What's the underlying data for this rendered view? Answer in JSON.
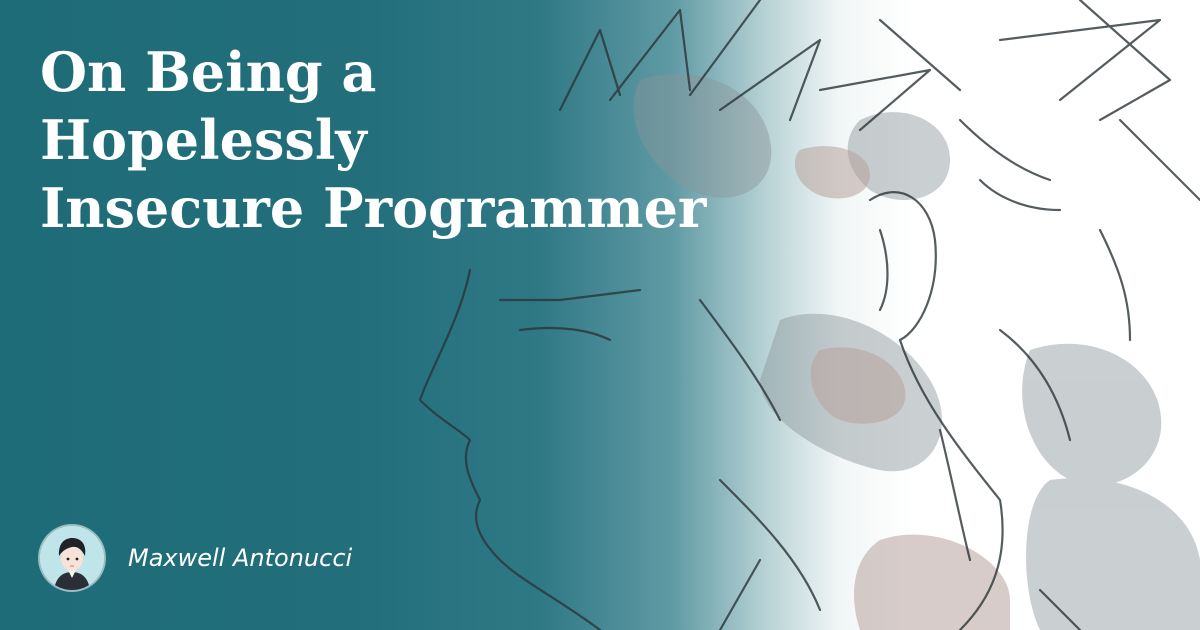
{
  "title_lines": [
    "On Being a",
    "Hopelessly",
    "Insecure Programmer"
  ],
  "author": {
    "name": "Maxwell Antonucci"
  },
  "colors": {
    "teal": "#1e6c78",
    "text": "#ffffff",
    "sketch_line": "#2b3438",
    "sketch_shade_gray": "#8a9599",
    "sketch_shade_pink": "#b7a39c"
  },
  "icons": {
    "avatar": "anime-portrait-avatar",
    "background": "sketched-face-illustration"
  }
}
